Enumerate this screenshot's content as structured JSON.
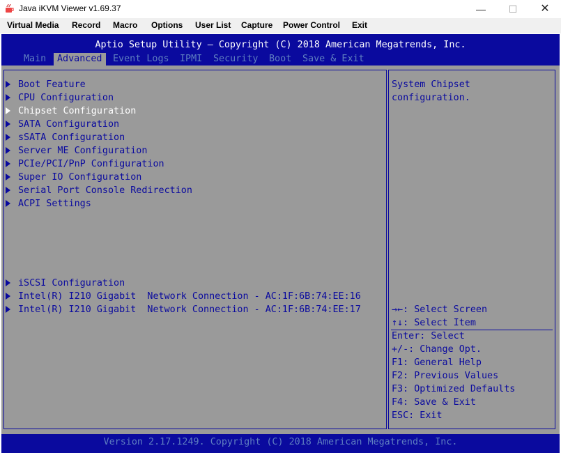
{
  "window": {
    "title": "Java iKVM Viewer v1.69.37",
    "minimize": "—",
    "maximize": "☐",
    "close": "✕"
  },
  "menu": {
    "items": [
      "Virtual Media",
      "Record",
      "Macro",
      "Options",
      "User List",
      "Capture",
      "Power Control",
      "Exit"
    ]
  },
  "bios": {
    "header": "Aptio Setup Utility – Copyright (C) 2018 American Megatrends, Inc.",
    "tabs": [
      "Main",
      "Advanced",
      "Event Logs",
      "IPMI",
      "Security",
      "Boot",
      "Save & Exit"
    ],
    "active_tab": "Advanced",
    "items": [
      "Boot Feature",
      "CPU Configuration",
      "Chipset Configuration",
      "SATA Configuration",
      "sSATA Configuration",
      "Server ME Configuration",
      "PCIe/PCI/PnP Configuration",
      "Super IO Configuration",
      "Serial Port Console Redirection",
      "ACPI Settings",
      "iSCSI Configuration",
      "Intel(R) I210 Gigabit  Network Connection - AC:1F:6B:74:EE:16",
      "Intel(R) I210 Gigabit  Network Connection - AC:1F:6B:74:EE:17"
    ],
    "selected_item": "Chipset Configuration",
    "help": "System Chipset\nconfiguration.",
    "keys": [
      "→←: Select Screen",
      "↑↓: Select Item",
      "Enter: Select",
      "+/-: Change Opt.",
      "F1: General Help",
      "F2: Previous Values",
      "F3: Optimized Defaults",
      "F4: Save & Exit",
      "ESC: Exit"
    ],
    "footer": "Version 2.17.1249. Copyright (C) 2018 American Megatrends, Inc."
  },
  "colors": {
    "bios_blue": "#0a0a9e",
    "bios_gray": "#9a9a9a",
    "dim_text": "#5f7fc0",
    "selected_text": "#ffffff"
  }
}
